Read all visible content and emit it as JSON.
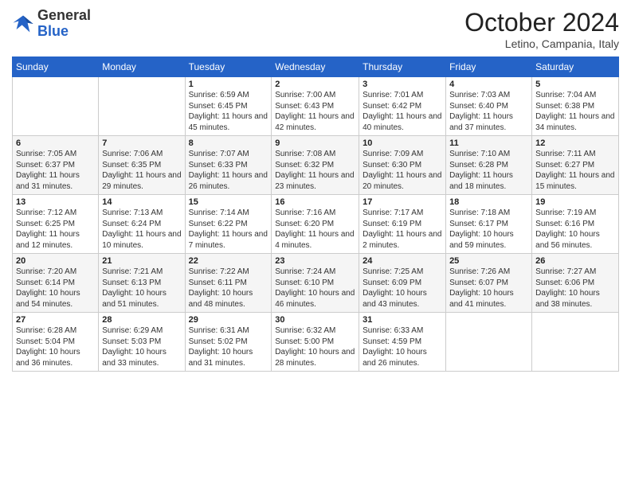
{
  "header": {
    "logo_general": "General",
    "logo_blue": "Blue",
    "month_title": "October 2024",
    "location": "Letino, Campania, Italy"
  },
  "days_of_week": [
    "Sunday",
    "Monday",
    "Tuesday",
    "Wednesday",
    "Thursday",
    "Friday",
    "Saturday"
  ],
  "weeks": [
    [
      {
        "day": "",
        "info": ""
      },
      {
        "day": "",
        "info": ""
      },
      {
        "day": "1",
        "info": "Sunrise: 6:59 AM\nSunset: 6:45 PM\nDaylight: 11 hours and 45 minutes."
      },
      {
        "day": "2",
        "info": "Sunrise: 7:00 AM\nSunset: 6:43 PM\nDaylight: 11 hours and 42 minutes."
      },
      {
        "day": "3",
        "info": "Sunrise: 7:01 AM\nSunset: 6:42 PM\nDaylight: 11 hours and 40 minutes."
      },
      {
        "day": "4",
        "info": "Sunrise: 7:03 AM\nSunset: 6:40 PM\nDaylight: 11 hours and 37 minutes."
      },
      {
        "day": "5",
        "info": "Sunrise: 7:04 AM\nSunset: 6:38 PM\nDaylight: 11 hours and 34 minutes."
      }
    ],
    [
      {
        "day": "6",
        "info": "Sunrise: 7:05 AM\nSunset: 6:37 PM\nDaylight: 11 hours and 31 minutes."
      },
      {
        "day": "7",
        "info": "Sunrise: 7:06 AM\nSunset: 6:35 PM\nDaylight: 11 hours and 29 minutes."
      },
      {
        "day": "8",
        "info": "Sunrise: 7:07 AM\nSunset: 6:33 PM\nDaylight: 11 hours and 26 minutes."
      },
      {
        "day": "9",
        "info": "Sunrise: 7:08 AM\nSunset: 6:32 PM\nDaylight: 11 hours and 23 minutes."
      },
      {
        "day": "10",
        "info": "Sunrise: 7:09 AM\nSunset: 6:30 PM\nDaylight: 11 hours and 20 minutes."
      },
      {
        "day": "11",
        "info": "Sunrise: 7:10 AM\nSunset: 6:28 PM\nDaylight: 11 hours and 18 minutes."
      },
      {
        "day": "12",
        "info": "Sunrise: 7:11 AM\nSunset: 6:27 PM\nDaylight: 11 hours and 15 minutes."
      }
    ],
    [
      {
        "day": "13",
        "info": "Sunrise: 7:12 AM\nSunset: 6:25 PM\nDaylight: 11 hours and 12 minutes."
      },
      {
        "day": "14",
        "info": "Sunrise: 7:13 AM\nSunset: 6:24 PM\nDaylight: 11 hours and 10 minutes."
      },
      {
        "day": "15",
        "info": "Sunrise: 7:14 AM\nSunset: 6:22 PM\nDaylight: 11 hours and 7 minutes."
      },
      {
        "day": "16",
        "info": "Sunrise: 7:16 AM\nSunset: 6:20 PM\nDaylight: 11 hours and 4 minutes."
      },
      {
        "day": "17",
        "info": "Sunrise: 7:17 AM\nSunset: 6:19 PM\nDaylight: 11 hours and 2 minutes."
      },
      {
        "day": "18",
        "info": "Sunrise: 7:18 AM\nSunset: 6:17 PM\nDaylight: 10 hours and 59 minutes."
      },
      {
        "day": "19",
        "info": "Sunrise: 7:19 AM\nSunset: 6:16 PM\nDaylight: 10 hours and 56 minutes."
      }
    ],
    [
      {
        "day": "20",
        "info": "Sunrise: 7:20 AM\nSunset: 6:14 PM\nDaylight: 10 hours and 54 minutes."
      },
      {
        "day": "21",
        "info": "Sunrise: 7:21 AM\nSunset: 6:13 PM\nDaylight: 10 hours and 51 minutes."
      },
      {
        "day": "22",
        "info": "Sunrise: 7:22 AM\nSunset: 6:11 PM\nDaylight: 10 hours and 48 minutes."
      },
      {
        "day": "23",
        "info": "Sunrise: 7:24 AM\nSunset: 6:10 PM\nDaylight: 10 hours and 46 minutes."
      },
      {
        "day": "24",
        "info": "Sunrise: 7:25 AM\nSunset: 6:09 PM\nDaylight: 10 hours and 43 minutes."
      },
      {
        "day": "25",
        "info": "Sunrise: 7:26 AM\nSunset: 6:07 PM\nDaylight: 10 hours and 41 minutes."
      },
      {
        "day": "26",
        "info": "Sunrise: 7:27 AM\nSunset: 6:06 PM\nDaylight: 10 hours and 38 minutes."
      }
    ],
    [
      {
        "day": "27",
        "info": "Sunrise: 6:28 AM\nSunset: 5:04 PM\nDaylight: 10 hours and 36 minutes."
      },
      {
        "day": "28",
        "info": "Sunrise: 6:29 AM\nSunset: 5:03 PM\nDaylight: 10 hours and 33 minutes."
      },
      {
        "day": "29",
        "info": "Sunrise: 6:31 AM\nSunset: 5:02 PM\nDaylight: 10 hours and 31 minutes."
      },
      {
        "day": "30",
        "info": "Sunrise: 6:32 AM\nSunset: 5:00 PM\nDaylight: 10 hours and 28 minutes."
      },
      {
        "day": "31",
        "info": "Sunrise: 6:33 AM\nSunset: 4:59 PM\nDaylight: 10 hours and 26 minutes."
      },
      {
        "day": "",
        "info": ""
      },
      {
        "day": "",
        "info": ""
      }
    ]
  ]
}
